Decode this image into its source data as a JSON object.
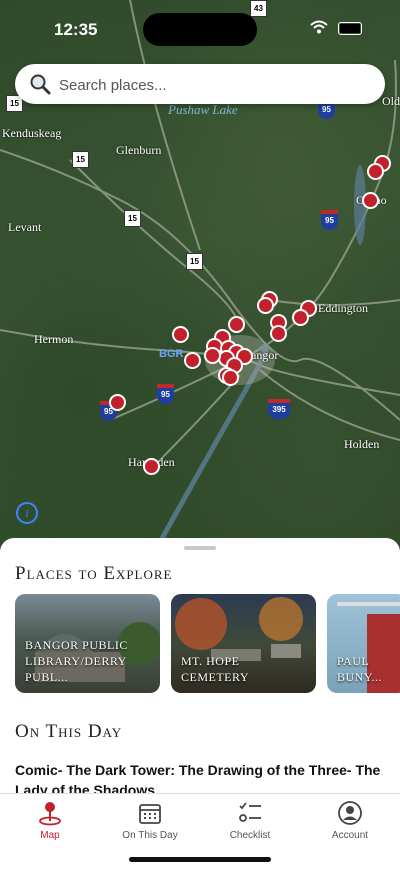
{
  "status": {
    "time": "12:35"
  },
  "search": {
    "placeholder": "Search places..."
  },
  "map": {
    "places": {
      "kenduskeag": "Kenduskeag",
      "glenburn": "Glenburn",
      "levant": "Levant",
      "hermon": "Hermon",
      "hampden": "Hampden",
      "eddington": "Eddington",
      "holden": "Holden",
      "orono": "Orono",
      "bangor": "Bangor",
      "old": "Old"
    },
    "lake": "Pushaw Lake",
    "airport": "BGR",
    "shields": {
      "r15a": "15",
      "r15b": "15",
      "r15c": "15",
      "r15d": "15",
      "i95a": "95",
      "i95b": "95",
      "i95c": "95",
      "i95d": "95",
      "i395": "395",
      "r43": "43"
    }
  },
  "sheet": {
    "places_title": "Places to Explore",
    "cards": [
      {
        "label": "Bangor Public Library/Derry Publ..."
      },
      {
        "label": "Mt. Hope Cemetery"
      },
      {
        "label": "Paul Buny..."
      }
    ],
    "on_this_day_title": "On This Day",
    "event_text": "Comic- The Dark Tower: The Drawing of the Three- The Lady of the Shadows"
  },
  "tabs": [
    {
      "label": "Map",
      "icon": "map-pin-icon"
    },
    {
      "label": "On This Day",
      "icon": "calendar-icon"
    },
    {
      "label": "Checklist",
      "icon": "checklist-icon"
    },
    {
      "label": "Account",
      "icon": "account-icon"
    }
  ],
  "colors": {
    "accent": "#c2202b",
    "pin": "#c2202b"
  }
}
